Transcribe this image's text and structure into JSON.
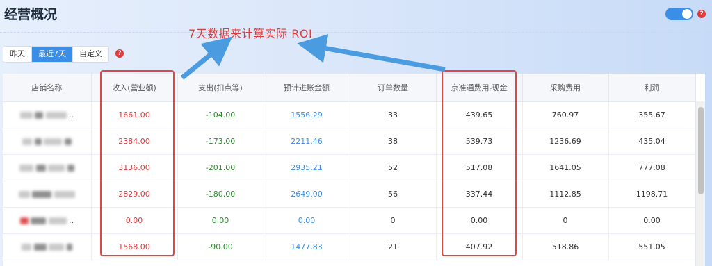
{
  "page": {
    "title": "经营概况"
  },
  "tabs": [
    {
      "label": "昨天",
      "active": false
    },
    {
      "label": "最近7天",
      "active": true
    },
    {
      "label": "自定义",
      "active": false
    }
  ],
  "annotation": {
    "text": "7天数据来计算实际 ROI",
    "color": "#e03a3a"
  },
  "colors": {
    "accent": "#3a8ee6",
    "income": "#e23b3b",
    "expense": "#2f8a2f",
    "settle": "#3a8ee6"
  },
  "table": {
    "headers": {
      "shop": "店铺名称",
      "income": "收入(营业额)",
      "expense": "支出(扣点等)",
      "settle": "预计进账金额",
      "orders": "订单数量",
      "jzt": "京准通费用-现金",
      "purchase": "采购费用",
      "profit": "利润"
    },
    "rows": [
      {
        "shop_suffix": "..",
        "income": "1661.00",
        "expense": "-104.00",
        "settle": "1556.29",
        "orders": "33",
        "jzt": "439.65",
        "purchase": "760.97",
        "profit": "355.67"
      },
      {
        "shop_suffix": "",
        "income": "2384.00",
        "expense": "-173.00",
        "settle": "2211.46",
        "orders": "38",
        "jzt": "539.73",
        "purchase": "1236.69",
        "profit": "435.04"
      },
      {
        "shop_suffix": "",
        "income": "3136.00",
        "expense": "-201.00",
        "settle": "2935.21",
        "orders": "52",
        "jzt": "517.08",
        "purchase": "1641.05",
        "profit": "777.08"
      },
      {
        "shop_suffix": "",
        "income": "2829.00",
        "expense": "-180.00",
        "settle": "2649.00",
        "orders": "56",
        "jzt": "337.44",
        "purchase": "1112.85",
        "profit": "1198.71"
      },
      {
        "shop_suffix": "..",
        "income": "0.00",
        "expense": "0.00",
        "settle": "0.00",
        "orders": "0",
        "jzt": "0.00",
        "purchase": "0",
        "profit": "0.00"
      },
      {
        "shop_suffix": "",
        "income": "1568.00",
        "expense": "-90.00",
        "settle": "1477.83",
        "orders": "21",
        "jzt": "407.92",
        "purchase": "518.86",
        "profit": "551.05"
      }
    ]
  }
}
